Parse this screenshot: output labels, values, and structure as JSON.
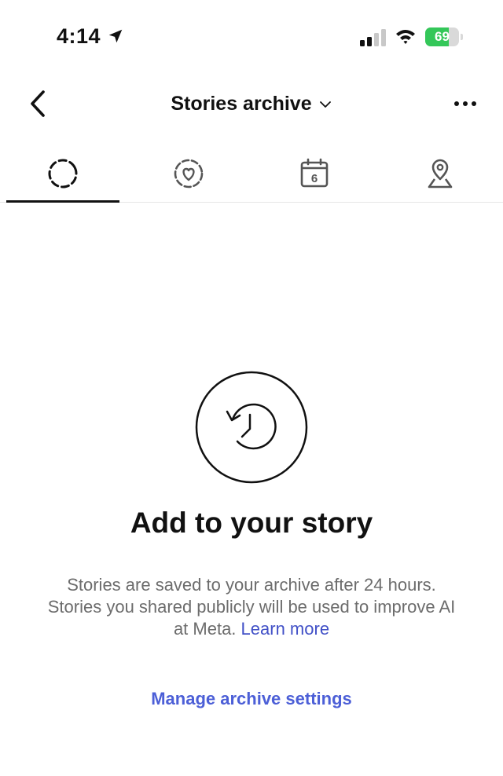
{
  "status_bar": {
    "time": "4:14",
    "battery_percent": "69",
    "battery_level": 0.69,
    "battery_color": "#34c759",
    "icons": [
      "location-arrow-icon",
      "cellular-signal-icon",
      "wifi-icon",
      "battery-charging-icon"
    ]
  },
  "header": {
    "title": "Stories archive",
    "back_icon": "chevron-left-icon",
    "dropdown_icon": "chevron-down-icon",
    "more_icon": "more-horizontal-icon"
  },
  "tabs": [
    {
      "name": "stories",
      "icon": "dashed-circle-icon",
      "active": true
    },
    {
      "name": "highlights",
      "icon": "heart-dashed-circle-icon",
      "active": false
    },
    {
      "name": "calendar",
      "icon": "calendar-icon",
      "calendar_day": "6",
      "active": false
    },
    {
      "name": "map",
      "icon": "map-pin-icon",
      "active": false
    }
  ],
  "empty_state": {
    "icon": "history-clock-icon",
    "title": "Add to your story",
    "description": "Stories are saved to your archive after 24 hours. Stories you shared publicly will be used to improve AI at Meta.",
    "learn_more": "Learn more",
    "manage_link": "Manage archive settings",
    "link_color": "#4c5fd7"
  }
}
